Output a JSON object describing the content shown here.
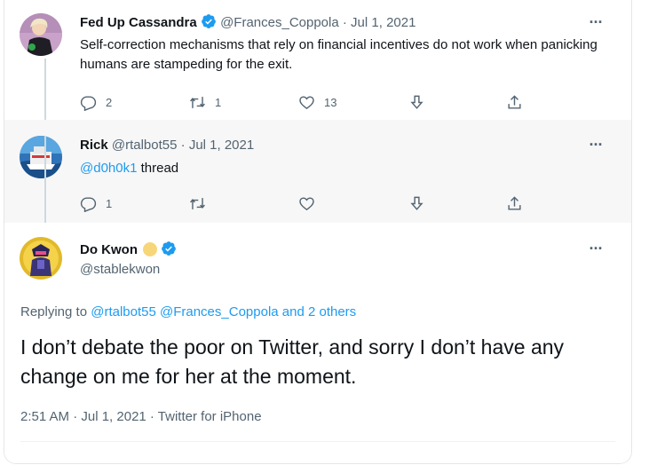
{
  "tweets": [
    {
      "name": "Fed Up Cassandra",
      "handle": "@Frances_Coppola",
      "date": "Jul 1, 2021",
      "text": "Self-correction mechanisms that rely on financial incentives do not work when panicking humans are stampeding for the exit.",
      "replies": "2",
      "retweets": "1",
      "likes": "13"
    },
    {
      "name": "Rick",
      "handle": "@rtalbot55",
      "date": "Jul 1, 2021",
      "mention": "@d0h0k1",
      "text": " thread",
      "replies": "1"
    }
  ],
  "main_tweet": {
    "name": "Do Kwon",
    "handle": "@stablekwon",
    "replying_prefix": "Replying to",
    "reply_mentions": "@rtalbot55 @Frances_Coppola and 2 others",
    "text": "I don’t debate the poor on Twitter, and sorry I don’t have any change on me for her at the moment.",
    "meta": "2:51 AM · Jul 1, 2021 · Twitter for iPhone"
  },
  "common": {
    "separator": "·",
    "more": "···"
  },
  "colors": {
    "accent": "#1d9bf0",
    "muted": "#536471",
    "text": "#0f1419",
    "verified": "#1d9bf0"
  },
  "icons": [
    "verified-badge-icon",
    "reply-icon",
    "retweet-icon",
    "like-icon",
    "share-icon",
    "upload-icon",
    "more-icon",
    "coin-emoji-icon"
  ]
}
